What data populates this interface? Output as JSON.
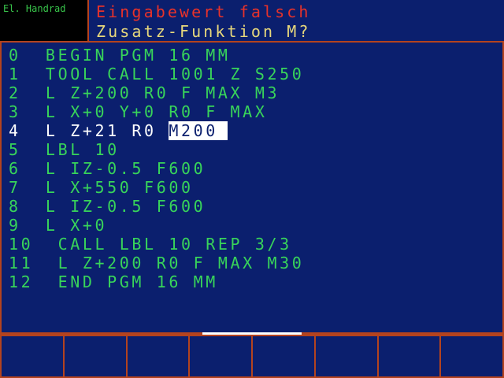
{
  "colors": {
    "background": "#0b1f6e",
    "frame": "#b4431e",
    "program_text": "#38d45a",
    "active_text": "#ffffff",
    "error_text": "#e8322a",
    "prompt_text": "#e8d87c",
    "mode_text": "#38c44a"
  },
  "mode": {
    "label": "El. Handrad"
  },
  "header": {
    "error_message": "Eingabewert falsch",
    "prompt": "Zusatz-Funktion M?"
  },
  "program": {
    "lines": [
      {
        "text": "0  BEGIN PGM 16 MM"
      },
      {
        "text": "1  TOOL CALL 1001 Z S250"
      },
      {
        "text": "2  L Z+200 R0 F MAX M3"
      },
      {
        "text": "3  L X+0 Y+0 R0 F MAX"
      },
      {
        "text": "4  L Z+21 R0 ",
        "field": "M200",
        "active": true
      },
      {
        "text": "5  LBL 10"
      },
      {
        "text": "6  L IZ-0.5 F600"
      },
      {
        "text": "7  L X+550 F600"
      },
      {
        "text": "8  L IZ-0.5 F600"
      },
      {
        "text": "9  L X+0"
      },
      {
        "text": "10  CALL LBL 10 REP 3/3"
      },
      {
        "text": "11  L Z+200 R0 F MAX M30"
      },
      {
        "text": "12  END PGM 16 MM"
      }
    ]
  },
  "softkeys": {
    "labels": [
      "",
      "",
      "",
      "",
      "",
      "",
      "",
      ""
    ]
  }
}
